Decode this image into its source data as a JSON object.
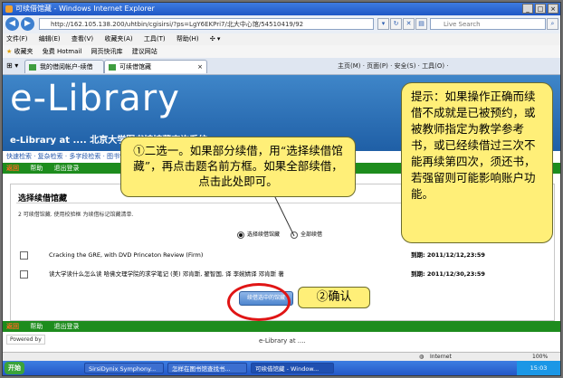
{
  "window": {
    "title": "可续借馆藏 - Windows Internet Explorer"
  },
  "address": {
    "url": "http://162.105.138.200/uhtbin/cgisirsi/?ps=LgY6EKPri7/北大中心馆/54510419/92",
    "search_placeholder": "Live Search"
  },
  "menu": [
    "文件(F)",
    "编辑(E)",
    "查看(V)",
    "收藏夹(A)",
    "工具(T)",
    "帮助(H)"
  ],
  "favorites": {
    "label": "收藏夹",
    "items": [
      "免费 Hotmail",
      "网页快讯库",
      "建议网站"
    ]
  },
  "tabs": [
    {
      "label": "我的借阅帐户-续借"
    },
    {
      "label": "可续借馆藏"
    }
  ],
  "commandbar": "主页(M) · 页面(P) · 安全(S) · 工具(O) ·",
  "site": {
    "brand": "e-Library",
    "subtitle": "e-Library at .... 北京大学图书馆馆藏查询系统"
  },
  "links": "快速检索 · 复杂检索 · 多字段检索 · 图书馆书目 · 新书通报",
  "greenbar": {
    "back": "返回",
    "help": "帮助",
    "logout": "退出登录"
  },
  "section": {
    "title": "选择续借馆藏",
    "instructions": "2 可续借馆藏. 使用校验框 为续借标记馆藏清单.",
    "radio_selected": "选择续借馆藏",
    "radio_all": "全部续借",
    "items": [
      {
        "title": "Cracking the GRE, with DVD   Princeton Review (Firm)",
        "due": "到期: 2011/12/12,23:59"
      },
      {
        "title": "读大学读什么怎么读 哈佛文理学院的求学笔记 (美) 邓肯斯, 翟智国, 译 李婉婧译   邓肯斯 著",
        "due": "到期: 2011/12/30,23:59"
      }
    ],
    "renew_button": "续借选中的馆藏"
  },
  "footer": {
    "powered": "Powered by",
    "title": "e-Library at ...."
  },
  "status": {
    "zone": "Internet",
    "zoom": "100%"
  },
  "taskbar": {
    "start": "开始",
    "tasks": [
      "SirsiDynix Symphony...",
      "怎样在图书馆查找书...",
      "可续借馆藏 - Window..."
    ],
    "clock": "15:03"
  },
  "callouts": {
    "c1": "①二选一。如果部分续借，用“选择续借馆藏”，再点击题名前方框。如果全部续借，点击此处即可。",
    "c2": "提示：如果操作正确而续借不成就是已被预约，或被教师指定为教学参考书，或已经续借过三次不能再续第四次，须还书，若强留则可能影响账户功能。",
    "c3": "②确认"
  },
  "colors": {
    "accent": "#1f5fa6",
    "green": "#1d8c1d",
    "callout": "#ffef78",
    "highlight": "#e01515"
  }
}
